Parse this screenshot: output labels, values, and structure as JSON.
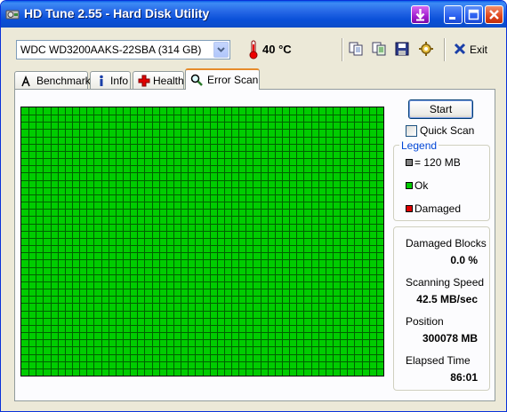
{
  "window": {
    "title": "HD Tune 2.55 - Hard Disk Utility"
  },
  "toolbar": {
    "drive": "WDC WD3200AAKS-22SBA (314 GB)",
    "temperature": "40 °C",
    "exit_label": "Exit"
  },
  "tabs": [
    {
      "label": "Benchmark"
    },
    {
      "label": "Info"
    },
    {
      "label": "Health"
    },
    {
      "label": "Error Scan"
    }
  ],
  "active_tab": "Error Scan",
  "controls": {
    "start_label": "Start",
    "quick_scan_label": "Quick Scan",
    "quick_scan_checked": false
  },
  "legend": {
    "title": "Legend",
    "items": [
      {
        "label": "= 120 MB",
        "color": "#808080"
      },
      {
        "label": "Ok",
        "color": "#00cc00"
      },
      {
        "label": "Damaged",
        "color": "#e00000"
      }
    ]
  },
  "stats": [
    {
      "label": "Damaged Blocks",
      "value": "0.0 %"
    },
    {
      "label": "Scanning Speed",
      "value": "42.5 MB/sec"
    },
    {
      "label": "Position",
      "value": "300078 MB"
    },
    {
      "label": "Elapsed Time",
      "value": "86:01"
    }
  ],
  "scan": {
    "block_color_ok": "#00cc00",
    "grid_line_color": "#006000",
    "damaged_blocks": 0
  }
}
